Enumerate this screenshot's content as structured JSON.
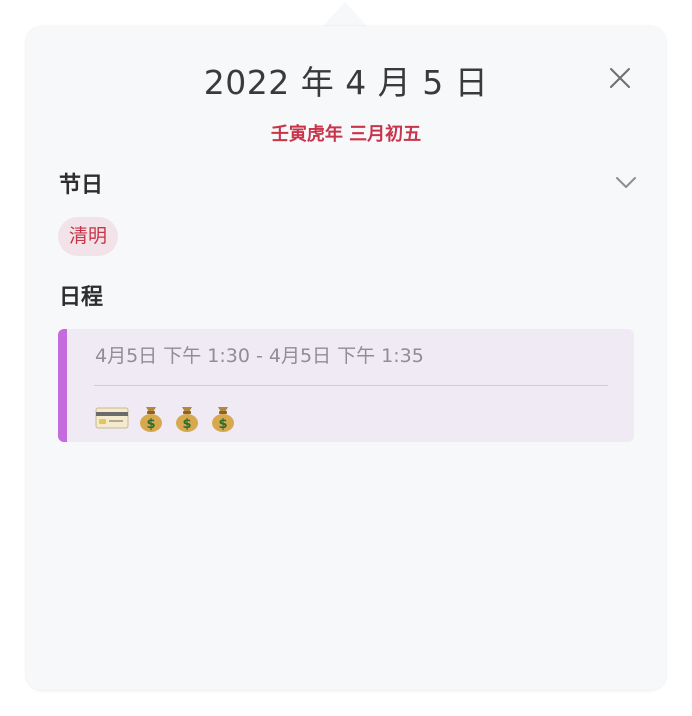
{
  "header": {
    "date_title": "2022 年 4 月 5 日",
    "lunar_date": "壬寅虎年 三月初五"
  },
  "holidays": {
    "section_title": "节日",
    "tag": "清明"
  },
  "schedule": {
    "section_title": "日程",
    "event": {
      "time_range": "4月5日 下午 1:30 - 4月5日 下午 1:35",
      "accent_color": "#c46bde",
      "icons": [
        "credit-card-icon",
        "money-bag-icon",
        "money-bag-icon",
        "money-bag-icon"
      ]
    }
  },
  "colors": {
    "accent_red": "#c8344a",
    "background": "#f7f8fa",
    "event_background": "#f0eaf4"
  }
}
